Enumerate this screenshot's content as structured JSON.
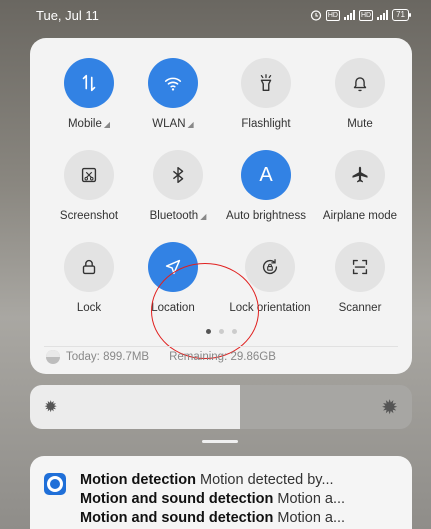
{
  "statusbar": {
    "time": "Tue, Jul 11",
    "icons": [
      "alarm-icon",
      "hd-icon",
      "5g-signal-icon",
      "hd-icon",
      "4g-signal-icon"
    ],
    "battery_level": "71"
  },
  "tiles": [
    {
      "label": "Mobile",
      "active": true,
      "icon": "mobile-data-icon",
      "has_menu": true
    },
    {
      "label": "WLAN",
      "active": true,
      "icon": "wifi-icon",
      "has_menu": true
    },
    {
      "label": "Flashlight",
      "active": false,
      "icon": "flashlight-icon"
    },
    {
      "label": "Mute",
      "active": false,
      "icon": "bell-icon"
    },
    {
      "label": "Screenshot",
      "active": false,
      "icon": "screenshot-icon"
    },
    {
      "label": "Bluetooth",
      "active": false,
      "icon": "bluetooth-icon",
      "has_menu": true
    },
    {
      "label": "Auto brightness",
      "active": true,
      "icon": "auto-brightness-icon"
    },
    {
      "label": "Airplane mode",
      "active": false,
      "icon": "airplane-icon"
    },
    {
      "label": "Lock",
      "active": false,
      "icon": "lock-icon"
    },
    {
      "label": "Location",
      "active": true,
      "icon": "location-icon"
    },
    {
      "label": "Lock orientation",
      "active": false,
      "icon": "rotation-lock-icon"
    },
    {
      "label": "Scanner",
      "active": false,
      "icon": "scanner-icon"
    }
  ],
  "auto_brightness_letter": "A",
  "pager": {
    "pages": 3,
    "current": 1
  },
  "data_usage": {
    "today": "Today: 899.7MB",
    "remaining": "Remaining: 29.86GB"
  },
  "brightness": {
    "level_fraction": 0.55
  },
  "notifications": [
    {
      "title": "Motion detection",
      "body": "Motion detected by..."
    },
    {
      "title": "Motion and sound detection",
      "body": "Motion a..."
    },
    {
      "title": "Motion and sound detection",
      "body": "Motion a..."
    }
  ],
  "colors": {
    "accent": "#3282e4",
    "highlight_ring": "#e0201f"
  }
}
